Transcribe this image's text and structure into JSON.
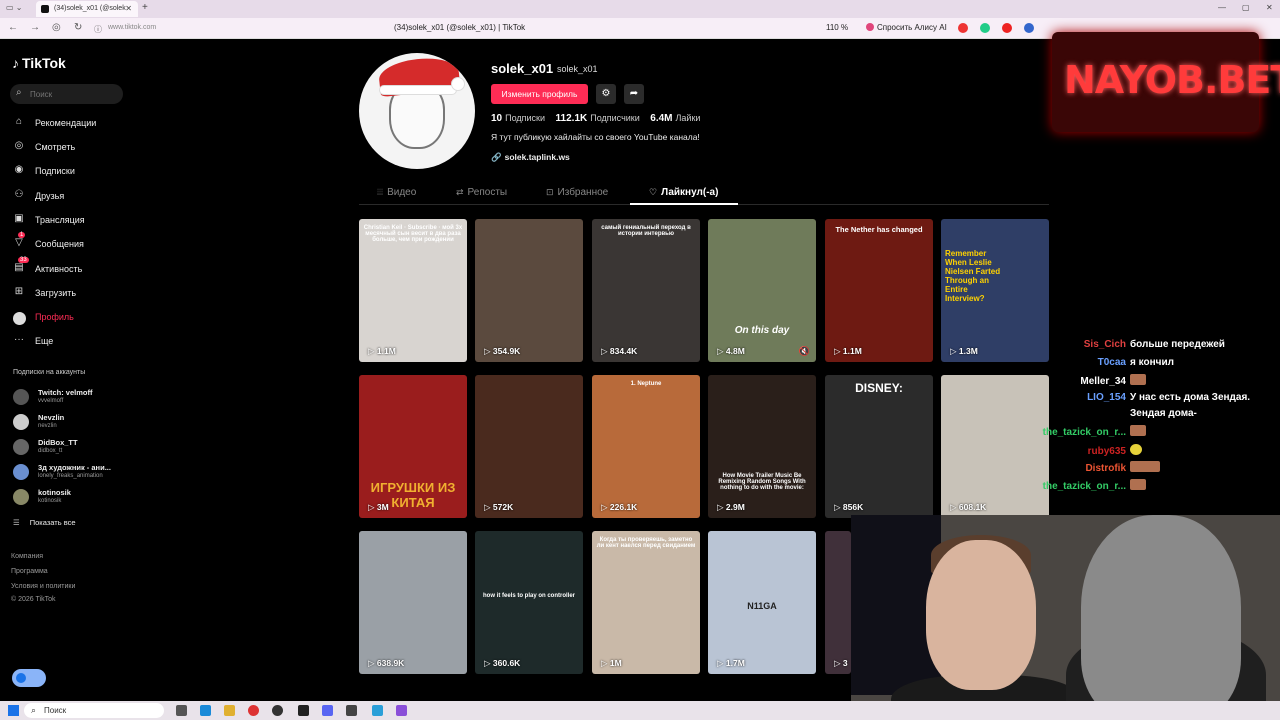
{
  "browser": {
    "tab_title": "(34)solek_x01 (@solek",
    "tab_close": "✕",
    "new_tab": "+",
    "url": "www.tiktok.com",
    "page_title": "(34)solek_x01 (@solek_x01) | TikTok",
    "zoom": "110 %",
    "alice": "Спросить Алису AI",
    "win_min": "—",
    "win_max": "▢",
    "win_close": "✕"
  },
  "sidebar": {
    "logo": "TikTok",
    "search_placeholder": "Поиск",
    "nav": [
      {
        "label": "Рекомендации",
        "icon": "⌂"
      },
      {
        "label": "Смотреть",
        "icon": "◎"
      },
      {
        "label": "Подписки",
        "icon": "◉"
      },
      {
        "label": "Друзья",
        "icon": "⚇"
      },
      {
        "label": "Трансляция",
        "icon": "▣"
      },
      {
        "label": "Сообщения",
        "icon": "▽",
        "badge": "1"
      },
      {
        "label": "Активность",
        "icon": "▤",
        "badge": "33"
      },
      {
        "label": "Загрузить",
        "icon": "⊞"
      },
      {
        "label": "Профиль",
        "icon": ""
      },
      {
        "label": "Еще",
        "icon": "···"
      }
    ],
    "follows_heading": "Подписки на аккаунты",
    "follows": [
      {
        "name": "Twitch: velmoff",
        "handle": "vvvelmoff"
      },
      {
        "name": "Nevzlin",
        "handle": "nevzlin"
      },
      {
        "name": "DidBox_TT",
        "handle": "didbox_tt"
      },
      {
        "name": "3д художник - ани...",
        "handle": "lonely_freaks_animation"
      },
      {
        "name": "kotinosik",
        "handle": "kotinosik"
      }
    ],
    "show_all": "Показать все",
    "footer": [
      "Компания",
      "Программа",
      "Условия и политики",
      "© 2026 TikTok"
    ]
  },
  "profile": {
    "username": "solek_x01",
    "nickname": "solek_x01",
    "edit_button": "Изменить профиль",
    "stats": [
      {
        "value": "10",
        "label": "Подписки"
      },
      {
        "value": "112.1K",
        "label": "Подписчики"
      },
      {
        "value": "6.4M",
        "label": "Лайки"
      }
    ],
    "bio": "Я тут публикую хайлайты со своего YouTube канала!",
    "link": "solek.taplink.ws"
  },
  "tabs": [
    {
      "label": "Видео",
      "icon": "⦙⦙⦙"
    },
    {
      "label": "Репосты",
      "icon": "⇄"
    },
    {
      "label": "Избранное",
      "icon": "⊡"
    },
    {
      "label": "Лайкнул(-а)",
      "icon": "♡"
    }
  ],
  "videos": [
    {
      "count": "1.1M",
      "caption": "Christian Keil · Subscribe · мой 3х месячный сын весит в два раза больше, чем при рождении",
      "bg": "#d8d4d0"
    },
    {
      "count": "354.9K",
      "caption": "",
      "bg": "#5b4a3e"
    },
    {
      "count": "834.4K",
      "caption": "самый гениальный переход в истории интервью",
      "bg": "#3a3634"
    },
    {
      "count": "4.8M",
      "caption": "On this day",
      "bg": "#6f7b5a"
    },
    {
      "count": "1.1M",
      "caption": "The Nether has changed",
      "bg": "#6e1a12"
    },
    {
      "count": "1.3M",
      "caption": "Remember When Leslie Nielsen Farted Through an Entire Interview?",
      "bg": "#2f3e66"
    },
    {
      "count": "3M",
      "caption": "ИГРУШКИ ИЗ КИТАЯ",
      "bg": "#9a1d1d"
    },
    {
      "count": "572K",
      "caption": "",
      "bg": "#4a2a1e"
    },
    {
      "count": "226.1K",
      "caption": "1. Neptune",
      "bg": "#b86a3a"
    },
    {
      "count": "2.9M",
      "caption": "How Movie Trailer Music Be Remixing Random Songs With nothing to do with the movie:",
      "bg": "#2a1f1a"
    },
    {
      "count": "856K",
      "caption": "DISNEY:",
      "bg": "#2b2b2b"
    },
    {
      "count": "608.1K",
      "caption": "",
      "bg": "#c8c2b8"
    },
    {
      "count": "638.9K",
      "caption": "",
      "bg": "#9aa0a6"
    },
    {
      "count": "360.6K",
      "caption": "how it feels to play on controller",
      "bg": "#1e2a2a"
    },
    {
      "count": "1M",
      "caption": "Когда ты проверяешь, заметно ли кент наелся перед свиданием",
      "bg": "#c9b9a8"
    },
    {
      "count": "1.7M",
      "caption": "N11GA",
      "bg": "#b9c4d4"
    },
    {
      "count": "3",
      "caption": "",
      "bg": "#40303a"
    }
  ],
  "overlay": {
    "banner": "NAYOB.BET",
    "chat": [
      {
        "user": "Sis_Cich",
        "msg": "больше передежей",
        "color": "#e04040"
      },
      {
        "user": "T0caa",
        "msg": "я кончил",
        "color": "#6aa0ff"
      },
      {
        "user": "Meller_34",
        "msg": "",
        "color": "#ffffff",
        "emote": "single"
      },
      {
        "user": "LIO_154",
        "msg": "У нас есть дома Зендая.",
        "color": "#6aa0ff"
      },
      {
        "user": "",
        "msg": "Зендая дома-",
        "color": "#ffffff"
      },
      {
        "user": "the_tazick_on_r...",
        "msg": "",
        "color": "#33cc66",
        "emote": "single"
      },
      {
        "user": "ruby635",
        "msg": "",
        "color": "#cc2222",
        "emote": "yellow"
      },
      {
        "user": "Distrofik",
        "msg": "",
        "color": "#ee5533",
        "emote": "wide"
      },
      {
        "user": "the_tazick_on_r...",
        "msg": "",
        "color": "#33cc66",
        "emote": "single"
      }
    ]
  },
  "taskbar": {
    "search": "Поиск"
  }
}
